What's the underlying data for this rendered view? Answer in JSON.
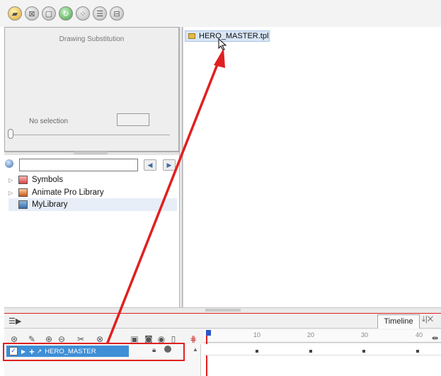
{
  "toolbar": {
    "icons": [
      "folder-open-icon",
      "library-icon",
      "square-icon",
      "refresh-icon",
      "palette-icon",
      "grid-icon",
      "sub-icon"
    ],
    "accent": "#3fa33f"
  },
  "substitution": {
    "title": "Drawing Substitution",
    "no_selection": "No selection"
  },
  "library": {
    "search_placeholder": "",
    "items": [
      {
        "label": "Symbols",
        "expandable": true
      },
      {
        "label": "Animate Pro Library",
        "expandable": true
      },
      {
        "label": "MyLibrary",
        "expandable": false,
        "selected": true
      }
    ]
  },
  "template": {
    "file_name": "HERO_MASTER.tpl"
  },
  "timeline": {
    "tab_label": "Timeline",
    "layer_name": "HERO_MASTER",
    "ruler": [
      "10",
      "20",
      "30",
      "40"
    ],
    "highlight_color": "#e02020",
    "selection_color": "#3f8fd6"
  }
}
